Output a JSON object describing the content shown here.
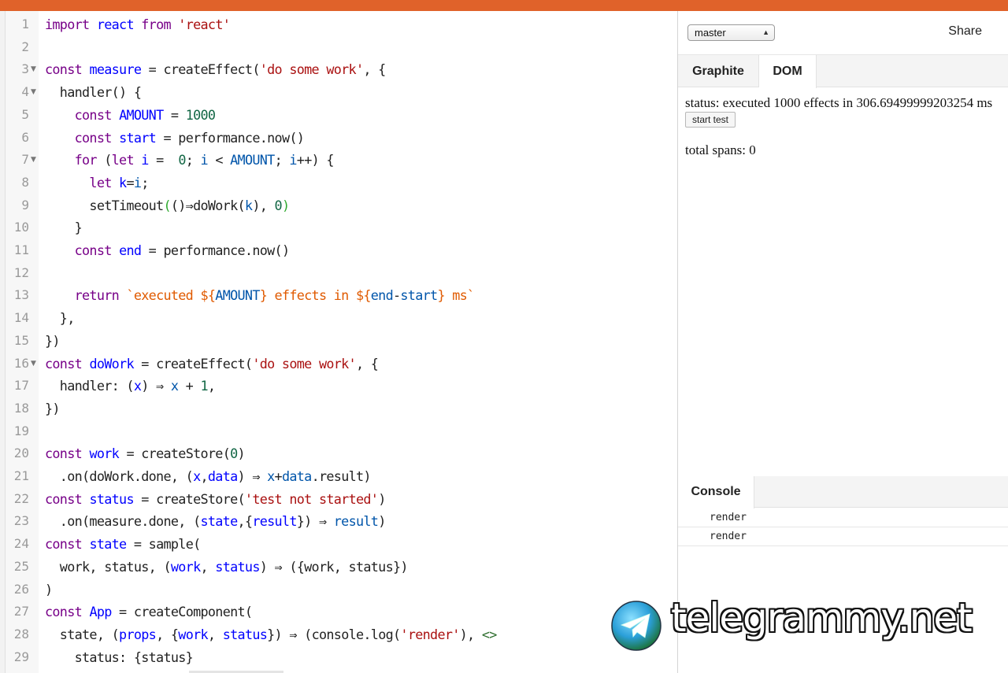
{
  "editor": {
    "lines": [
      {
        "n": "1",
        "fold": false,
        "t": [
          [
            "k",
            "import"
          ],
          [
            "p",
            " "
          ],
          [
            "d",
            "react"
          ],
          [
            "p",
            " "
          ],
          [
            "k",
            "from"
          ],
          [
            "p",
            " "
          ],
          [
            "s",
            "'react'"
          ]
        ]
      },
      {
        "n": "2",
        "fold": false,
        "t": []
      },
      {
        "n": "3",
        "fold": true,
        "t": [
          [
            "k",
            "const"
          ],
          [
            "p",
            " "
          ],
          [
            "d",
            "measure"
          ],
          [
            "p",
            " = createEffect("
          ],
          [
            "s",
            "'do some work'"
          ],
          [
            "p",
            ", {"
          ]
        ]
      },
      {
        "n": "4",
        "fold": true,
        "t": [
          [
            "p",
            "  handler() {"
          ]
        ]
      },
      {
        "n": "5",
        "fold": false,
        "t": [
          [
            "p",
            "    "
          ],
          [
            "k",
            "const"
          ],
          [
            "p",
            " "
          ],
          [
            "d",
            "AMOUNT"
          ],
          [
            "p",
            " = "
          ],
          [
            "n",
            "1000"
          ]
        ]
      },
      {
        "n": "6",
        "fold": false,
        "t": [
          [
            "p",
            "    "
          ],
          [
            "k",
            "const"
          ],
          [
            "p",
            " "
          ],
          [
            "d",
            "start"
          ],
          [
            "p",
            " = performance.now()"
          ]
        ]
      },
      {
        "n": "7",
        "fold": true,
        "t": [
          [
            "p",
            "    "
          ],
          [
            "k",
            "for"
          ],
          [
            "p",
            " ("
          ],
          [
            "k",
            "let"
          ],
          [
            "p",
            " "
          ],
          [
            "d",
            "i"
          ],
          [
            "p",
            " =  "
          ],
          [
            "n",
            "0"
          ],
          [
            "p",
            "; "
          ],
          [
            "v",
            "i"
          ],
          [
            "p",
            " < "
          ],
          [
            "v",
            "AMOUNT"
          ],
          [
            "p",
            "; "
          ],
          [
            "v",
            "i"
          ],
          [
            "p",
            "++) {"
          ]
        ]
      },
      {
        "n": "8",
        "fold": false,
        "t": [
          [
            "p",
            "      "
          ],
          [
            "k",
            "let"
          ],
          [
            "p",
            " "
          ],
          [
            "d",
            "k"
          ],
          [
            "p",
            "="
          ],
          [
            "v",
            "i"
          ],
          [
            "p",
            ";"
          ]
        ]
      },
      {
        "n": "9",
        "fold": false,
        "t": [
          [
            "p",
            "      setTimeout"
          ],
          [
            "b",
            "("
          ],
          [
            "p",
            "()⇒doWork("
          ],
          [
            "v",
            "k"
          ],
          [
            "p",
            "), "
          ],
          [
            "n",
            "0"
          ],
          [
            "b",
            ")"
          ]
        ]
      },
      {
        "n": "10",
        "fold": false,
        "t": [
          [
            "p",
            "    }"
          ]
        ]
      },
      {
        "n": "11",
        "fold": false,
        "t": [
          [
            "p",
            "    "
          ],
          [
            "k",
            "const"
          ],
          [
            "p",
            " "
          ],
          [
            "d",
            "end"
          ],
          [
            "p",
            " = performance.now()"
          ]
        ]
      },
      {
        "n": "12",
        "fold": false,
        "t": []
      },
      {
        "n": "13",
        "fold": false,
        "t": [
          [
            "p",
            "    "
          ],
          [
            "k",
            "return"
          ],
          [
            "p",
            " "
          ],
          [
            "t",
            "`executed ${"
          ],
          [
            "v",
            "AMOUNT"
          ],
          [
            "t",
            "} effects in ${"
          ],
          [
            "v",
            "end"
          ],
          [
            "p",
            "-"
          ],
          [
            "v",
            "start"
          ],
          [
            "t",
            "} ms`"
          ]
        ]
      },
      {
        "n": "14",
        "fold": false,
        "t": [
          [
            "p",
            "  },"
          ]
        ]
      },
      {
        "n": "15",
        "fold": false,
        "t": [
          [
            "p",
            "})"
          ]
        ]
      },
      {
        "n": "16",
        "fold": true,
        "t": [
          [
            "k",
            "const"
          ],
          [
            "p",
            " "
          ],
          [
            "d",
            "doWork"
          ],
          [
            "p",
            " = createEffect("
          ],
          [
            "s",
            "'do some work'"
          ],
          [
            "p",
            ", {"
          ]
        ]
      },
      {
        "n": "17",
        "fold": false,
        "t": [
          [
            "p",
            "  handler: ("
          ],
          [
            "d",
            "x"
          ],
          [
            "p",
            ") ⇒ "
          ],
          [
            "v",
            "x"
          ],
          [
            "p",
            " + "
          ],
          [
            "n",
            "1"
          ],
          [
            "p",
            ","
          ]
        ]
      },
      {
        "n": "18",
        "fold": false,
        "t": [
          [
            "p",
            "})"
          ]
        ]
      },
      {
        "n": "19",
        "fold": false,
        "t": []
      },
      {
        "n": "20",
        "fold": false,
        "t": [
          [
            "k",
            "const"
          ],
          [
            "p",
            " "
          ],
          [
            "d",
            "work"
          ],
          [
            "p",
            " = createStore("
          ],
          [
            "n",
            "0"
          ],
          [
            "p",
            ")"
          ]
        ]
      },
      {
        "n": "21",
        "fold": false,
        "t": [
          [
            "p",
            "  .on(doWork.done, ("
          ],
          [
            "d",
            "x"
          ],
          [
            "p",
            ","
          ],
          [
            "d",
            "data"
          ],
          [
            "p",
            ") ⇒ "
          ],
          [
            "v",
            "x"
          ],
          [
            "p",
            "+"
          ],
          [
            "v",
            "data"
          ],
          [
            "p",
            ".result)"
          ]
        ]
      },
      {
        "n": "22",
        "fold": false,
        "t": [
          [
            "k",
            "const"
          ],
          [
            "p",
            " "
          ],
          [
            "d",
            "status"
          ],
          [
            "p",
            " = createStore("
          ],
          [
            "s",
            "'test not started'"
          ],
          [
            "p",
            ")"
          ]
        ]
      },
      {
        "n": "23",
        "fold": false,
        "t": [
          [
            "p",
            "  .on(measure.done, ("
          ],
          [
            "d",
            "state"
          ],
          [
            "p",
            ",{"
          ],
          [
            "d",
            "result"
          ],
          [
            "p",
            "}) ⇒ "
          ],
          [
            "v",
            "result"
          ],
          [
            "p",
            ")"
          ]
        ]
      },
      {
        "n": "24",
        "fold": false,
        "t": [
          [
            "k",
            "const"
          ],
          [
            "p",
            " "
          ],
          [
            "d",
            "state"
          ],
          [
            "p",
            " = sample("
          ]
        ]
      },
      {
        "n": "25",
        "fold": false,
        "t": [
          [
            "p",
            "  work, status, ("
          ],
          [
            "d",
            "work"
          ],
          [
            "p",
            ", "
          ],
          [
            "d",
            "status"
          ],
          [
            "p",
            ") ⇒ ({work, status})"
          ]
        ]
      },
      {
        "n": "26",
        "fold": false,
        "t": [
          [
            "p",
            ")"
          ]
        ]
      },
      {
        "n": "27",
        "fold": false,
        "t": [
          [
            "k",
            "const"
          ],
          [
            "p",
            " "
          ],
          [
            "d",
            "App"
          ],
          [
            "p",
            " = createComponent("
          ]
        ]
      },
      {
        "n": "28",
        "fold": false,
        "t": [
          [
            "p",
            "  state, ("
          ],
          [
            "d",
            "props"
          ],
          [
            "p",
            ", {"
          ],
          [
            "d",
            "work"
          ],
          [
            "p",
            ", "
          ],
          [
            "d",
            "status"
          ],
          [
            "p",
            "}) ⇒ (console.log("
          ],
          [
            "s",
            "'render'"
          ],
          [
            "p",
            "), "
          ],
          [
            "m",
            "<>"
          ]
        ]
      },
      {
        "n": "29",
        "fold": false,
        "t": [
          [
            "p",
            "    status: {status}"
          ]
        ]
      }
    ]
  },
  "toolbar": {
    "branch_value": "master",
    "share_label": "Share"
  },
  "tabs": [
    "Graphite",
    "DOM"
  ],
  "preview": {
    "status_text": "status: executed 1000 effects in 306.69499999203254 ms",
    "start_button": "start test",
    "spans_text": "total spans: 0"
  },
  "console": {
    "tab_label": "Console",
    "rows": [
      "render",
      "render"
    ]
  },
  "watermark": {
    "text": "telegrammy.net",
    "icon": "telegram-plane-icon"
  },
  "colors": {
    "topbar": "#e0622a",
    "keyword": "#770088",
    "definition": "#0000ff",
    "variable": "#0055aa",
    "string": "#aa1111",
    "number": "#116644",
    "template": "#e05a00"
  }
}
